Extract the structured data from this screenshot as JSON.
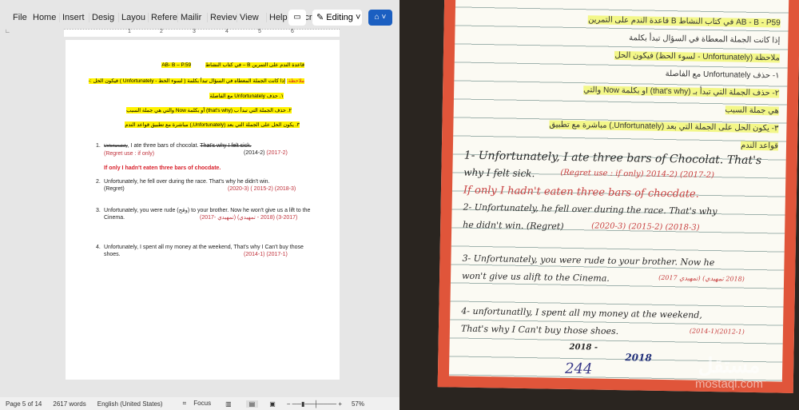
{
  "ribbon": {
    "tabs": [
      "File",
      "Home",
      "Insert",
      "Desig",
      "Layou",
      "Refere",
      "Mailir",
      "Reviev",
      "View",
      "Help",
      "Acrob"
    ],
    "editing_label": "Editing"
  },
  "ruler": {
    "ticks": [
      "1",
      "2",
      "3",
      "4",
      "5",
      "6"
    ]
  },
  "document": {
    "title_ar": "قاعدة الندم على التمرين B – في كتاب النشاط",
    "title_ref": "AB- B – P.59",
    "note_label": "ملاحظة:",
    "note": "إذا كانت الجملة المعطاه في السؤال تبدأ بكلمة ( لسوء الحظ - Unfortunately ) فيكون الحل :-",
    "rules": [
      "١. حذف Unfortunately مع الفاصلة",
      "٢. حذف الجملة التي تبدأ ب (that's why) أو بكلمة Now والتي هي جملة السبب",
      "٣. يكون الحل على الجملة التي بعد (Unfortunately,) مباشرة مع تطبيق قواعد الندم"
    ],
    "questions": [
      {
        "num": "1.",
        "strike1": "Unfortunately",
        "text": ", I ate three bars of chocolat. ",
        "strike2": "That's why I felt sick.",
        "sub": "(Regret use : if only)",
        "years_black": "(2014-2)",
        "years": "(2017-2)",
        "answer": "If only I hadn't eaten three bars of chocdate."
      },
      {
        "num": "2.",
        "text": "Unfortunately, he fell over during the race. That's why he didn't win.",
        "sub": "(Regret)",
        "years": "(2020-3) ( 2015-2) (2018-3)"
      },
      {
        "num": "3.",
        "text": "Unfortunately, you were rude (وقح) to your brother. Now he won't give us a lift to the Cinema.",
        "years": "(2017- تمهيدي) (2018 - تمهيدي) (2017-3)"
      },
      {
        "num": "4.",
        "text": "Unfortunately, I spent all my money at the weekend, That's why I Can't buy those shoes.",
        "years": "(2014-1) (2017-1)"
      }
    ]
  },
  "status": {
    "page": "Page 5 of 14",
    "words": "2617 words",
    "language": "English (United States)",
    "focus": "Focus",
    "zoom": "57%"
  },
  "photo": {
    "lines_ar": [
      "AB - B - P59 في كتاب النشاط B قاعدة الندم على التمرين",
      "إذا كانت الجملة المعطاة في السؤال تبدأ بكلمة",
      "ملاحظة (Unfortunately - لسوء الحظ) فيكون الحل",
      "١- حذف Unfortunately مع الفاصلة",
      "٢- حذف الجملة التي تبدأ بـ (that's why) او بكلمة Now والتي",
      "هي جملة السبب",
      "٣- يكون الحل على الجملة التي بعد (Unfortunately,) مباشرة مع تطبيق",
      "قواعد الندم"
    ],
    "lines": [
      "1- Unfortunately, I ate three bars of Chocolat. That's",
      "why I felt sick.",
      "(Regret use : if only) 2014-2) (2017-2)",
      "If only I hadn't eaten three bars of chocdate.",
      "2- Unfortunately, he fell over during the race. That's why",
      "he didn't win. (Regret)",
      "(2020-3) (2015-2) (2018-3)",
      "3- Unfortunately, you were rude to your brother. Now he",
      "won't give us alift to the Cinema.",
      "(2017 تمهيدي) (2018 تمهيدي)",
      "4- unfortunatlly, I spent all my money at the weekend,",
      "That's why I Can't buy those shoes.",
      "(2014-1)(2012-1)",
      "2018 -",
      "2018",
      "244"
    ],
    "watermark": "مستقل",
    "watermark_url": "mostaql.com"
  }
}
